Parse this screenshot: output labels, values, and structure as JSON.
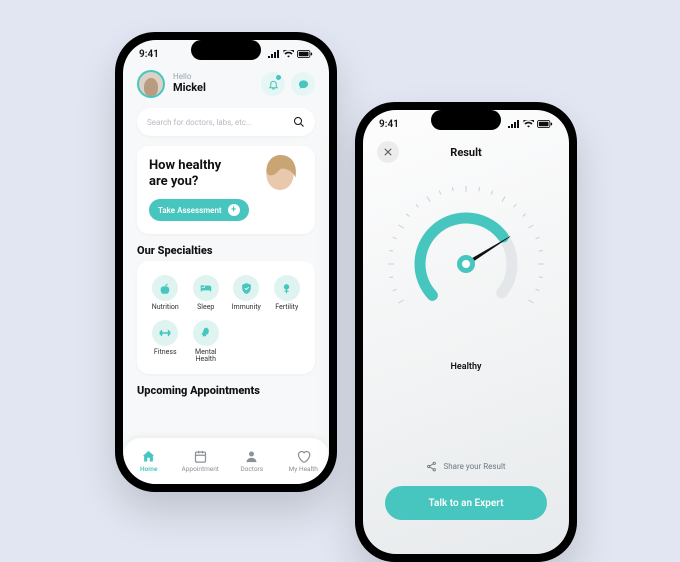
{
  "status_bar": {
    "time": "9:41"
  },
  "home": {
    "greeting": "Hello",
    "user_name": "Mickel",
    "search_placeholder": "Search for doctors, labs, etc...",
    "hero": {
      "title": "How healthy are you?",
      "cta_label": "Take Assessment"
    },
    "specialties_title": "Our Specialties",
    "specialties": [
      {
        "label": "Nutrition"
      },
      {
        "label": "Sleep"
      },
      {
        "label": "Immunity"
      },
      {
        "label": "Fertility"
      },
      {
        "label": "Fitness"
      },
      {
        "label": "Mental Health"
      }
    ],
    "upcoming_title": "Upcoming Appointments",
    "tabs": [
      {
        "label": "Home"
      },
      {
        "label": "Appointment"
      },
      {
        "label": "Doctors"
      },
      {
        "label": "My Health"
      }
    ]
  },
  "result": {
    "title": "Result",
    "status": "Healthy",
    "share_label": "Share your Result",
    "cta_label": "Talk to an Expert"
  },
  "colors": {
    "accent": "#46C6BE",
    "accent_light": "#DFF3F1"
  }
}
